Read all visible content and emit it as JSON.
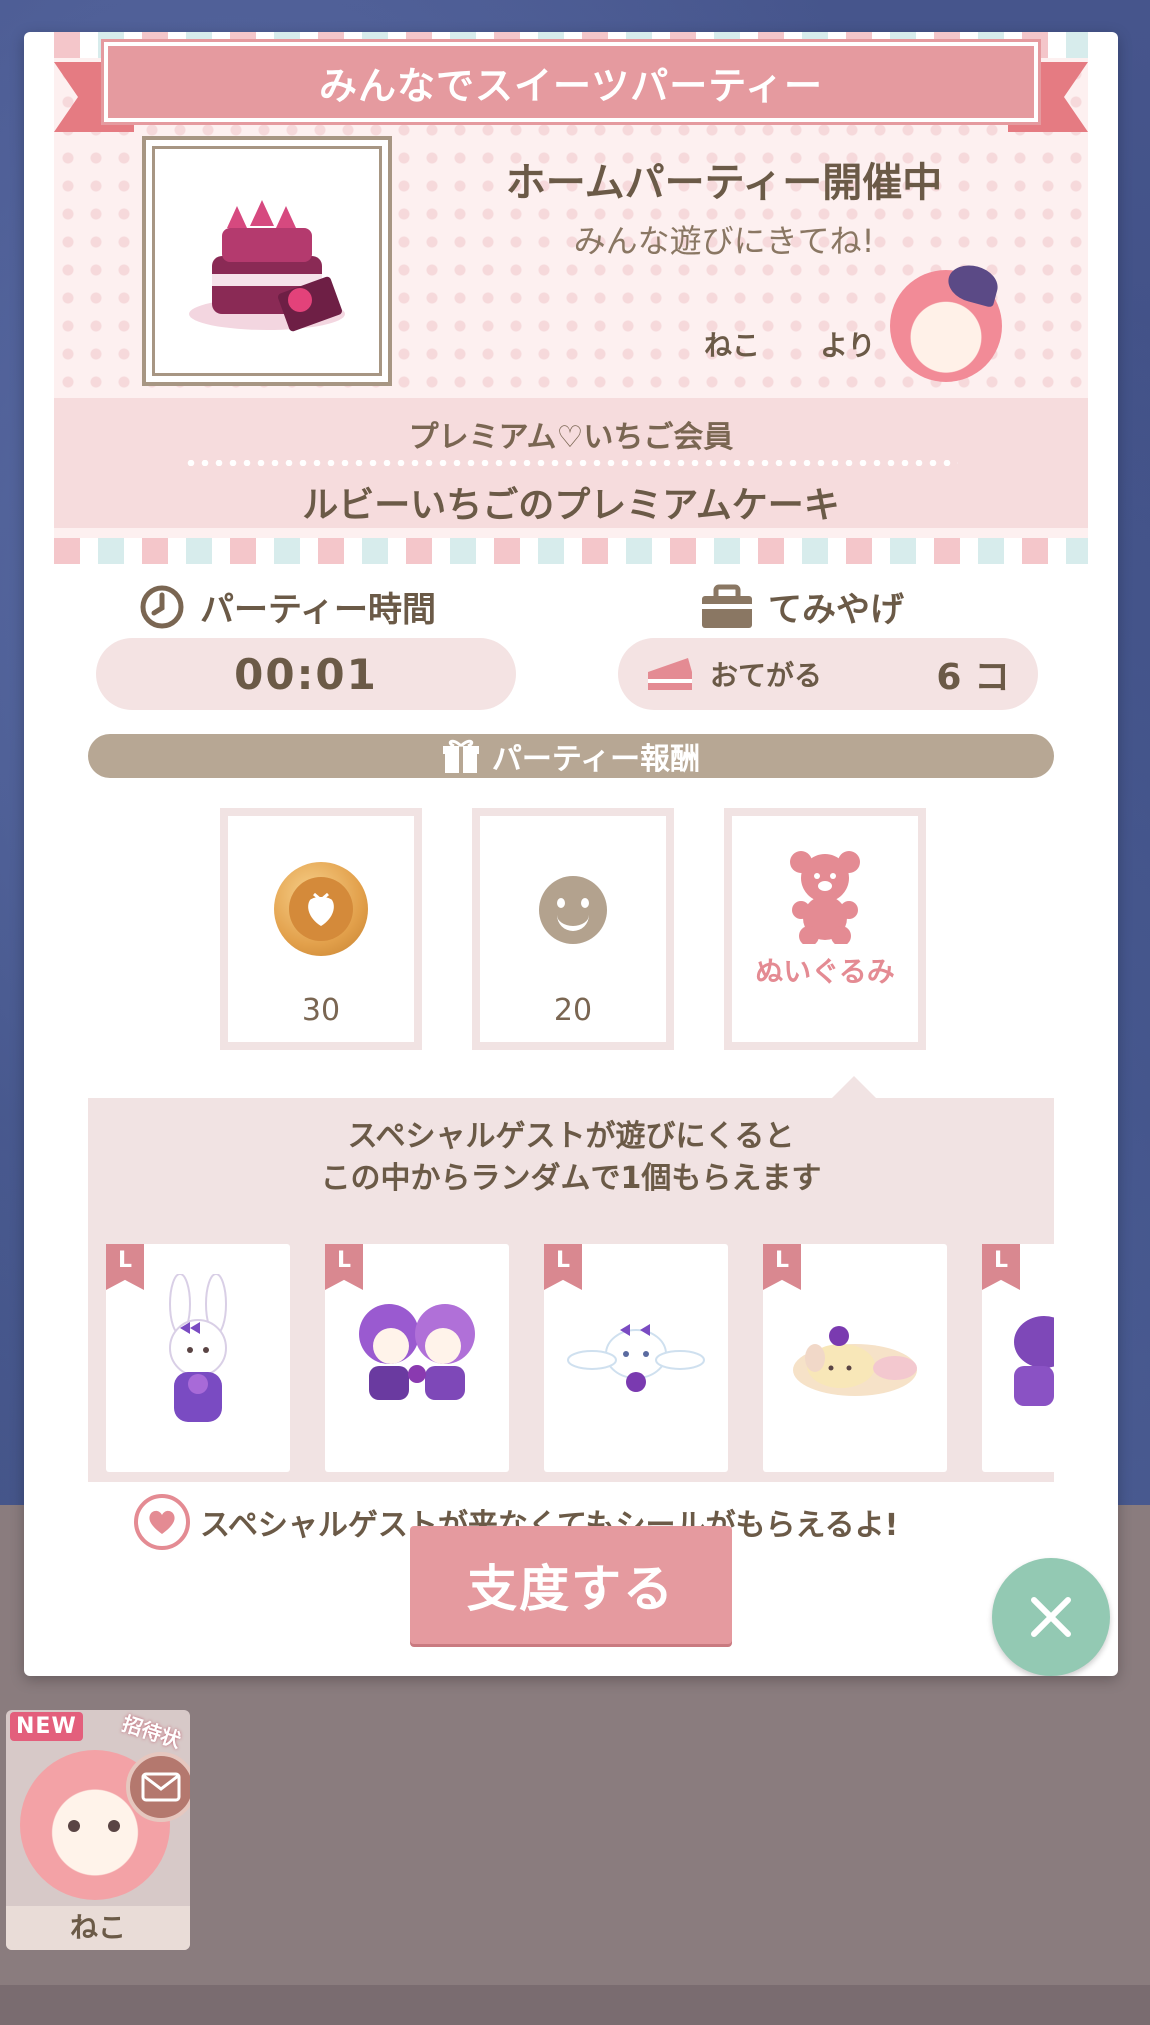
{
  "banner": {
    "title": "みんなでスイーツパーティー"
  },
  "party": {
    "status": "ホームパーティー開催中",
    "message": "みんな遊びにきてね!",
    "host_name": "ねこ",
    "host_suffix": "より"
  },
  "membership": {
    "tier": "プレミアム♡いちご会員",
    "item_name": "ルビーいちごのプレミアムケーキ"
  },
  "party_time": {
    "label": "パーティー時間",
    "value": "00:01"
  },
  "souvenir": {
    "label": "てみやげ",
    "item": "おてがる",
    "count": "6 コ"
  },
  "rewards": {
    "header": "パーティー報酬",
    "items": [
      {
        "icon": "strawberry-coin-icon",
        "amount": "30"
      },
      {
        "icon": "smiley-icon",
        "amount": "20"
      },
      {
        "icon": "teddy-bear-icon",
        "label": "ぬいぐるみ"
      }
    ]
  },
  "special_guest": {
    "line1": "スペシャルゲストが遊びにくると",
    "line2": "この中からランダムで1個もらえます",
    "badge": "L",
    "plushies": [
      "bunny-plush",
      "twin-stars-plush",
      "cinnamoroll-plush",
      "pompompurin-plush",
      "my-melody-plush"
    ]
  },
  "note": "スペシャルゲストが来なくてもシールがもらえるよ!",
  "buttons": {
    "prepare": "支度する"
  },
  "visitor": {
    "new_tag": "NEW",
    "invite_tag": "招待状",
    "name": "ねこ"
  },
  "colors": {
    "accent_pink": "#e59a9f",
    "brown_text": "#6b5a47",
    "close_green": "#93c9b3",
    "panel_pink": "#f1e3e3"
  }
}
